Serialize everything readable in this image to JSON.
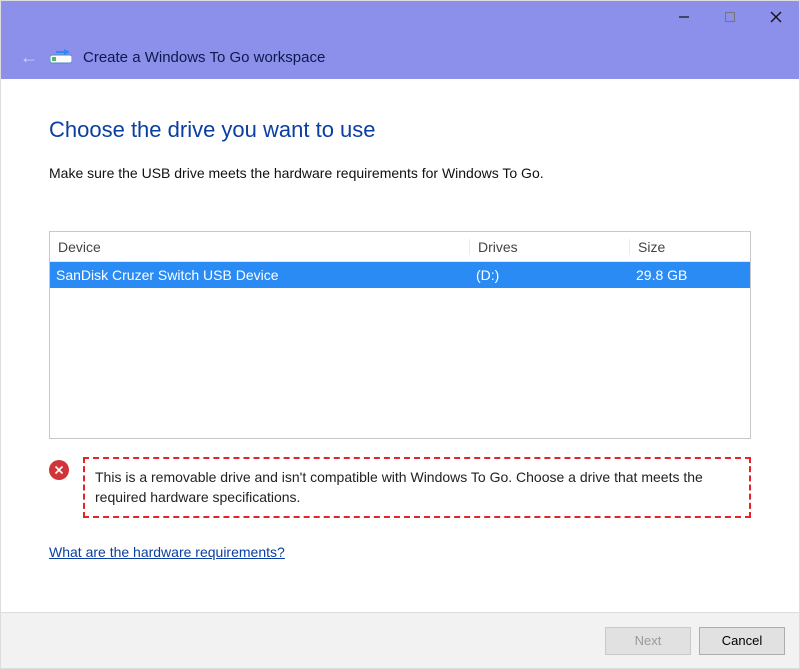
{
  "window": {
    "title": "Create a Windows To Go workspace"
  },
  "page": {
    "heading": "Choose the drive you want to use",
    "subtext": "Make sure the USB drive meets the hardware requirements for Windows To Go."
  },
  "table": {
    "headers": {
      "device": "Device",
      "drives": "Drives",
      "size": "Size"
    },
    "rows": [
      {
        "device": "SanDisk Cruzer Switch USB Device",
        "drives": "(D:)",
        "size": "29.8 GB"
      }
    ]
  },
  "error": {
    "message": "This is a removable drive and isn't compatible with Windows To Go. Choose a drive that meets the required hardware specifications."
  },
  "help": {
    "link_text": "What are the hardware requirements?"
  },
  "footer": {
    "next_label": "Next",
    "cancel_label": "Cancel"
  }
}
